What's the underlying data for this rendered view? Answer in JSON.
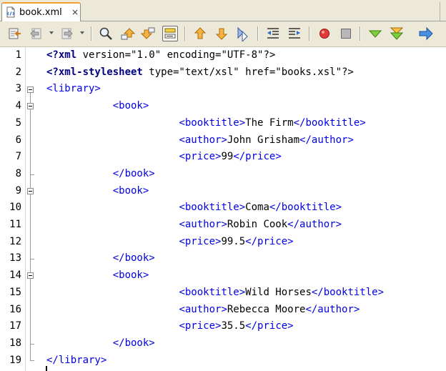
{
  "tab": {
    "title": "book.xml",
    "close_glyph": "×",
    "icon": "xml-file-icon"
  },
  "toolbar": {
    "buttons": [
      "last-edit-icon",
      "back-icon",
      "forward-icon",
      "find-selection-icon",
      "find-previous-icon",
      "find-next-icon",
      "toggle-highlight-search-icon",
      "previous-bookmark-icon",
      "next-bookmark-icon",
      "toggle-bookmark-icon",
      "shift-left-icon",
      "shift-right-icon",
      "start-macro-recording-icon",
      "stop-macro-recording-icon",
      "check-xml-icon",
      "validate-xml-icon",
      "xsl-transformation-icon"
    ]
  },
  "editor": {
    "lines": [
      {
        "num": "1",
        "tokens": [
          [
            "kw",
            "<?xml"
          ],
          [
            "txt",
            " version=\"1.0\" encoding=\"UTF-8\"?>"
          ]
        ]
      },
      {
        "num": "2",
        "tokens": [
          [
            "kw",
            "<?xml-stylesheet"
          ],
          [
            "txt",
            " type=\"text/xsl\" href=\"books.xsl\"?>"
          ]
        ]
      },
      {
        "num": "3",
        "tokens": [
          [
            "tag",
            "<library>"
          ]
        ]
      },
      {
        "num": "4",
        "tokens": [
          [
            "txt",
            "           "
          ],
          [
            "tag",
            "<book>"
          ]
        ]
      },
      {
        "num": "5",
        "tokens": [
          [
            "txt",
            "                      "
          ],
          [
            "tag",
            "<booktitle>"
          ],
          [
            "txt",
            "The Firm"
          ],
          [
            "tag",
            "</booktitle>"
          ]
        ]
      },
      {
        "num": "6",
        "tokens": [
          [
            "txt",
            "                      "
          ],
          [
            "tag",
            "<author>"
          ],
          [
            "txt",
            "John Grisham"
          ],
          [
            "tag",
            "</author>"
          ]
        ]
      },
      {
        "num": "7",
        "tokens": [
          [
            "txt",
            "                      "
          ],
          [
            "tag",
            "<price>"
          ],
          [
            "txt",
            "99"
          ],
          [
            "tag",
            "</price>"
          ]
        ]
      },
      {
        "num": "8",
        "tokens": [
          [
            "txt",
            "           "
          ],
          [
            "tag",
            "</book>"
          ]
        ]
      },
      {
        "num": "9",
        "tokens": [
          [
            "txt",
            "           "
          ],
          [
            "tag",
            "<book>"
          ]
        ]
      },
      {
        "num": "10",
        "tokens": [
          [
            "txt",
            "                      "
          ],
          [
            "tag",
            "<booktitle>"
          ],
          [
            "txt",
            "Coma"
          ],
          [
            "tag",
            "</booktitle>"
          ]
        ]
      },
      {
        "num": "11",
        "tokens": [
          [
            "txt",
            "                      "
          ],
          [
            "tag",
            "<author>"
          ],
          [
            "txt",
            "Robin Cook"
          ],
          [
            "tag",
            "</author>"
          ]
        ]
      },
      {
        "num": "12",
        "tokens": [
          [
            "txt",
            "                      "
          ],
          [
            "tag",
            "<price>"
          ],
          [
            "txt",
            "99.5"
          ],
          [
            "tag",
            "</price>"
          ]
        ]
      },
      {
        "num": "13",
        "tokens": [
          [
            "txt",
            "           "
          ],
          [
            "tag",
            "</book>"
          ]
        ]
      },
      {
        "num": "14",
        "tokens": [
          [
            "txt",
            "           "
          ],
          [
            "tag",
            "<book>"
          ]
        ]
      },
      {
        "num": "15",
        "tokens": [
          [
            "txt",
            "                      "
          ],
          [
            "tag",
            "<booktitle>"
          ],
          [
            "txt",
            "Wild Horses"
          ],
          [
            "tag",
            "</booktitle>"
          ]
        ]
      },
      {
        "num": "16",
        "tokens": [
          [
            "txt",
            "                      "
          ],
          [
            "tag",
            "<author>"
          ],
          [
            "txt",
            "Rebecca Moore"
          ],
          [
            "tag",
            "</author>"
          ]
        ]
      },
      {
        "num": "17",
        "tokens": [
          [
            "txt",
            "                      "
          ],
          [
            "tag",
            "<price>"
          ],
          [
            "txt",
            "35.5"
          ],
          [
            "tag",
            "</price>"
          ]
        ]
      },
      {
        "num": "18",
        "tokens": [
          [
            "txt",
            "           "
          ],
          [
            "tag",
            "</book>"
          ]
        ]
      },
      {
        "num": "19",
        "tokens": [
          [
            "tag",
            "</library>"
          ]
        ]
      }
    ],
    "fold_starts": [
      "3",
      "4",
      "9",
      "14"
    ],
    "fold_ends": [
      "8",
      "13",
      "18",
      "19"
    ]
  },
  "colors": {
    "tag": "#0000e6",
    "xml_declaration": "#000080",
    "text": "#000000",
    "toolbar_bg": "#ece9d8",
    "tab_accent": "#f0a030"
  }
}
